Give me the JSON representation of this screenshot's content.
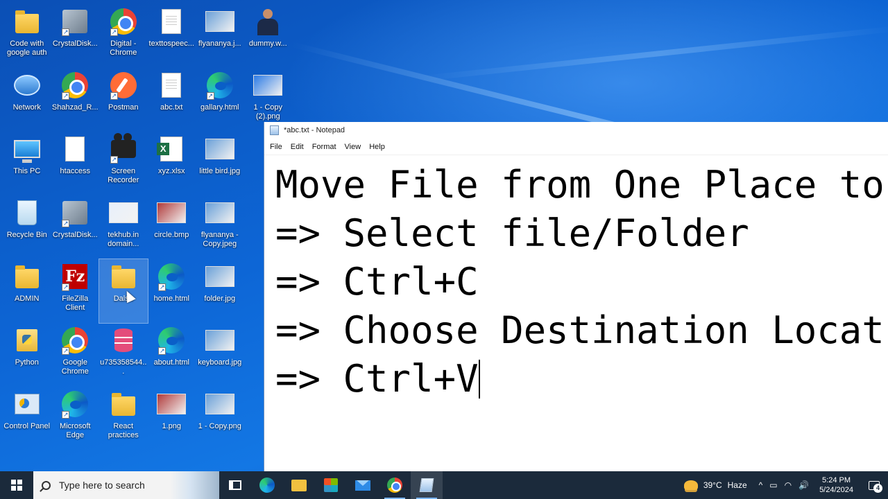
{
  "desktop": {
    "icons": [
      {
        "label": "Code with google auth",
        "icon": "folder"
      },
      {
        "label": "CrystalDisk...",
        "icon": "crystal"
      },
      {
        "label": "Digital - Chrome",
        "icon": "chrome"
      },
      {
        "label": "texttospeec...",
        "icon": "doc"
      },
      {
        "label": "flyananya.j...",
        "icon": "imgthumb"
      },
      {
        "label": "dummy.w...",
        "icon": "person"
      },
      {
        "label": "Network",
        "icon": "network"
      },
      {
        "label": "Shahzad_R...",
        "icon": "chrome"
      },
      {
        "label": "Postman",
        "icon": "postman"
      },
      {
        "label": "abc.txt",
        "icon": "doc"
      },
      {
        "label": "gallary.html",
        "icon": "edge"
      },
      {
        "label": "1 - Copy (2).png",
        "icon": "imgthumb"
      },
      {
        "label": "This PC",
        "icon": "pc"
      },
      {
        "label": "htaccess",
        "icon": "htaccess"
      },
      {
        "label": "Screen Recorder",
        "icon": "camera"
      },
      {
        "label": "xyz.xlsx",
        "icon": "excel"
      },
      {
        "label": "little bird.jpg",
        "icon": "imgthumb"
      },
      {
        "label": "",
        "icon": "none"
      },
      {
        "label": "Recycle Bin",
        "icon": "bin"
      },
      {
        "label": "CrystalDisk...",
        "icon": "crystal"
      },
      {
        "label": "tekhub.in domain...",
        "icon": "imgthumb"
      },
      {
        "label": "circle.bmp",
        "icon": "imgthumb"
      },
      {
        "label": "flyananya - Copy.jpeg",
        "icon": "imgthumb"
      },
      {
        "label": "",
        "icon": "none"
      },
      {
        "label": "ADMIN",
        "icon": "folder"
      },
      {
        "label": "FileZilla Client",
        "icon": "filezilla"
      },
      {
        "label": "Dalsh",
        "icon": "folder"
      },
      {
        "label": "home.html",
        "icon": "edge"
      },
      {
        "label": "folder.jpg",
        "icon": "imgthumb"
      },
      {
        "label": "",
        "icon": "none"
      },
      {
        "label": "Python",
        "icon": "python"
      },
      {
        "label": "Google Chrome",
        "icon": "chrome"
      },
      {
        "label": "u735358544...",
        "icon": "db"
      },
      {
        "label": "about.html",
        "icon": "edge"
      },
      {
        "label": "keyboard.jpg",
        "icon": "imgthumb"
      },
      {
        "label": "",
        "icon": "none"
      },
      {
        "label": "Control Panel",
        "icon": "cpanel"
      },
      {
        "label": "Microsoft Edge",
        "icon": "edge"
      },
      {
        "label": "React practices",
        "icon": "folder"
      },
      {
        "label": "1.png",
        "icon": "imgthumb"
      },
      {
        "label": "1 - Copy.png",
        "icon": "imgthumb"
      },
      {
        "label": "",
        "icon": "none"
      }
    ]
  },
  "notepad": {
    "title": "*abc.txt - Notepad",
    "menu": [
      "File",
      "Edit",
      "Format",
      "View",
      "Help"
    ],
    "lines": [
      "Move File from One Place to",
      "=> Select file/Folder",
      "=> Ctrl+C",
      "=> Choose Destination Locat",
      "=> Ctrl+V"
    ]
  },
  "taskbar": {
    "search_placeholder": "Type here to search",
    "pinned": [
      "task-view",
      "edge",
      "file-explorer",
      "microsoft-store",
      "mail",
      "chrome",
      "notepad"
    ],
    "weather": {
      "temp": "39°C",
      "condition": "Haze"
    },
    "clock": {
      "time": "5:24 PM",
      "date": "5/24/2024"
    },
    "notification_count": "4",
    "tray_symbols": [
      "^",
      "▭",
      "◠",
      "🔊"
    ]
  },
  "colors": {
    "taskbar_bg": "#1b2a3b",
    "desktop_blue": "#0d66d6",
    "active_indicator": "#7db7ff"
  }
}
